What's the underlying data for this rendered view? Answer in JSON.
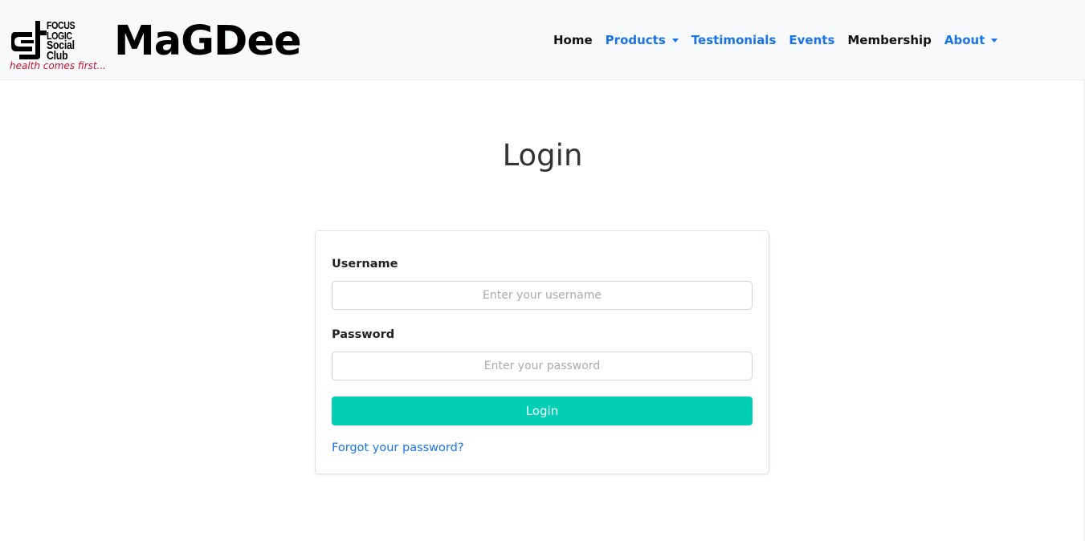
{
  "brand": {
    "logo_lines": [
      "FOCUS",
      "LOGIC",
      "Social Club"
    ],
    "tagline": "health comes first...",
    "site_name": "MaGDee"
  },
  "nav": {
    "items": [
      {
        "label": "Home",
        "dropdown": false
      },
      {
        "label": "Products",
        "dropdown": true
      },
      {
        "label": "Testimonials",
        "dropdown": false
      },
      {
        "label": "Events",
        "dropdown": false
      },
      {
        "label": "Membership",
        "dropdown": false
      },
      {
        "label": "About",
        "dropdown": true
      }
    ]
  },
  "page": {
    "title": "Login"
  },
  "form": {
    "username_label": "Username",
    "username_placeholder": "Enter your username",
    "username_value": "",
    "password_label": "Password",
    "password_placeholder": "Enter your password",
    "password_value": "",
    "submit_label": "Login",
    "forgot_link": "Forgot your password?"
  },
  "colors": {
    "accent_button": "#00cfb4",
    "link_blue": "#1a73e8",
    "tagline_red": "#c8102e",
    "navbar_bg": "#f8f9fa"
  }
}
